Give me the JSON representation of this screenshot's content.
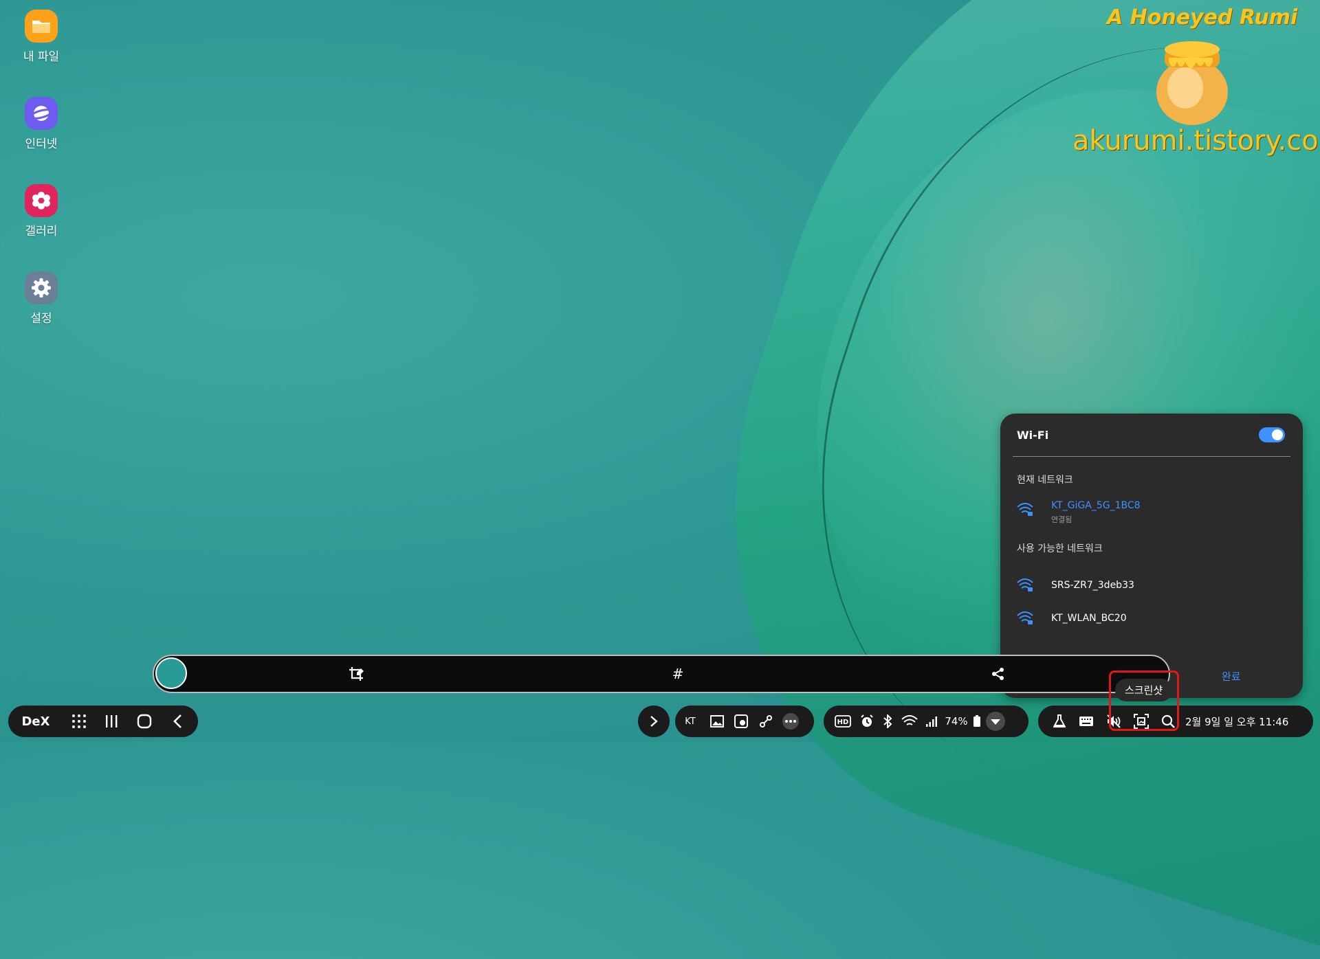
{
  "desktop": {
    "icons": [
      {
        "label": "내 파일",
        "icon": "folder-icon",
        "color": "#ffa21a"
      },
      {
        "label": "인터넷",
        "icon": "internet-icon",
        "color": "#6f5bf0"
      },
      {
        "label": "갤러리",
        "icon": "gallery-icon",
        "color": "#e0245e"
      },
      {
        "label": "설정",
        "icon": "settings-gear-icon",
        "color": "#6b7f99"
      }
    ]
  },
  "watermark": {
    "title": "A Honeyed Rumi",
    "url": "akurumi.tistory.com"
  },
  "wifi": {
    "title": "Wi-Fi",
    "enabled": true,
    "current_label": "현재 네트워크",
    "current": {
      "name": "KT_GiGA_5G_1BC8",
      "status": "연결됨"
    },
    "available_label": "사용 가능한 네트워크",
    "available": [
      {
        "name": "SRS-ZR7_3deb33"
      },
      {
        "name": "KT_WLAN_BC20"
      }
    ],
    "done": "완료",
    "accent": "#3e91ff"
  },
  "screenshot_toolbar": {
    "tag_symbol": "#"
  },
  "tooltip": {
    "text": "스크린샷"
  },
  "taskbar": {
    "dex_label": "DeX",
    "carrier": "KT",
    "battery": "74%",
    "datetime": "2월 9일 일 오후 11:46"
  }
}
